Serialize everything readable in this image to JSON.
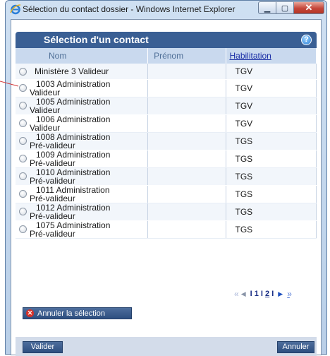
{
  "window": {
    "title": "Sélection du contact dossier - Windows Internet Explorer"
  },
  "header": {
    "title": "Sélection d'un contact",
    "help_icon": "help-icon"
  },
  "table": {
    "columns": [
      "Nom",
      "Prénom",
      "Habilitation"
    ],
    "rows": [
      {
        "nom": "Ministère 3 Valideur",
        "prenom": "",
        "habilitation": "TGV"
      },
      {
        "nom": "1003 Administration Valideur",
        "prenom": "",
        "habilitation": "TGV"
      },
      {
        "nom": "1005 Administration Valideur",
        "prenom": "",
        "habilitation": "TGV"
      },
      {
        "nom": "1006 Administration Valideur",
        "prenom": "",
        "habilitation": "TGV"
      },
      {
        "nom": "1008 Administration Pré-valideur",
        "prenom": "",
        "habilitation": "TGS"
      },
      {
        "nom": "1009 Administration Pré-valideur",
        "prenom": "",
        "habilitation": "TGS"
      },
      {
        "nom": "1010 Administration Pré-valideur",
        "prenom": "",
        "habilitation": "TGS"
      },
      {
        "nom": "1011 Administration Pré-valideur",
        "prenom": "",
        "habilitation": "TGS"
      },
      {
        "nom": "1012 Administration Pré-valideur",
        "prenom": "",
        "habilitation": "TGS"
      },
      {
        "nom": "1075 Administration Pré-valideur",
        "prenom": "",
        "habilitation": "TGS"
      }
    ],
    "row_lines": [
      [
        "Ministère 3 Valideur"
      ],
      [
        "1003 Administration",
        "Valideur"
      ],
      [
        "1005 Administration",
        "Valideur"
      ],
      [
        "1006 Administration",
        "Valideur"
      ],
      [
        "1008 Administration",
        "Pré-valideur"
      ],
      [
        "1009 Administration",
        "Pré-valideur"
      ],
      [
        "1010 Administration",
        "Pré-valideur"
      ],
      [
        "1011 Administration",
        "Pré-valideur"
      ],
      [
        "1012 Administration",
        "Pré-valideur"
      ],
      [
        "1075 Administration",
        "Pré-valideur"
      ]
    ]
  },
  "pager": {
    "current": "1",
    "page2": "2"
  },
  "buttons": {
    "annuler_selection": "Annuler la sélection",
    "valider": "Valider",
    "annuler": "Annuler"
  },
  "colors": {
    "header": "#3a5f94",
    "button": "#2e4f80",
    "close": "#c5463a"
  }
}
